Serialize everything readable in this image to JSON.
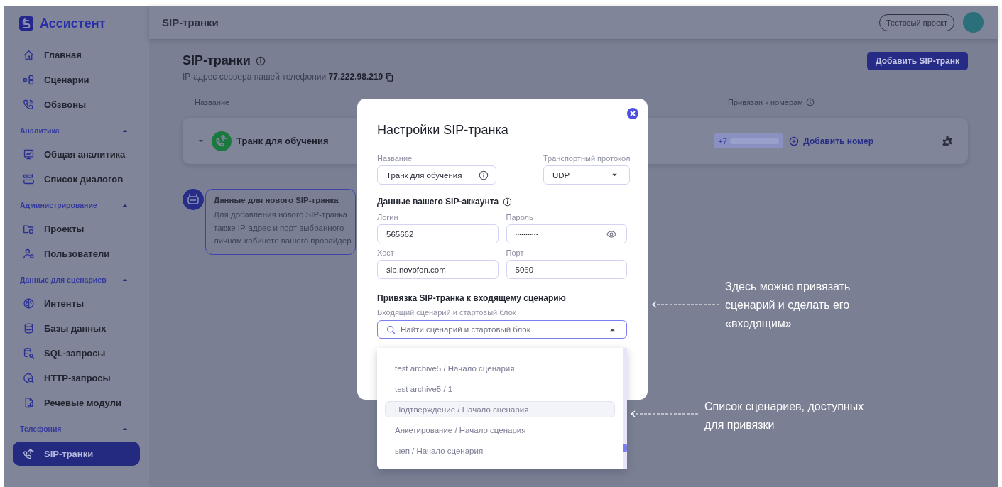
{
  "sidebar": {
    "logo": "Ассистент",
    "nav": [
      {
        "kind": "item",
        "label": "Главная",
        "selected": false
      },
      {
        "kind": "item",
        "label": "Сценарии",
        "selected": false
      },
      {
        "kind": "item",
        "label": "Обзвоны",
        "selected": false
      },
      {
        "kind": "section",
        "label": "Аналитика",
        "expanded": true,
        "children": [
          {
            "kind": "item",
            "label": "Общая аналитика",
            "selected": false
          },
          {
            "kind": "item",
            "label": "Список диалогов",
            "selected": false
          }
        ]
      },
      {
        "kind": "section",
        "label": "Администрирование",
        "expanded": true,
        "children": [
          {
            "kind": "item",
            "label": "Проекты",
            "selected": false
          },
          {
            "kind": "item",
            "label": "Пользователи",
            "selected": false
          }
        ]
      },
      {
        "kind": "section",
        "label": "Данные для сценариев",
        "expanded": true,
        "children": [
          {
            "kind": "item",
            "label": "Интенты",
            "selected": false
          },
          {
            "kind": "item",
            "label": "Базы данных",
            "selected": false
          },
          {
            "kind": "item",
            "label": "SQL-запросы",
            "selected": false
          },
          {
            "kind": "item",
            "label": "HTTP-запросы",
            "selected": false
          },
          {
            "kind": "item",
            "label": "Речевые модули",
            "selected": false
          }
        ]
      },
      {
        "kind": "section",
        "label": "Телефония",
        "expanded": true,
        "children": [
          {
            "kind": "item",
            "label": "SIP-транки",
            "selected": true
          }
        ]
      }
    ]
  },
  "header": {
    "title": "SIP-транки",
    "project": "Тестовый проект"
  },
  "page": {
    "title": "SIP-транки",
    "server_ip": "IP-адрес сервера нашей телефонии **77.222.98.219**",
    "add_button": "Добавить SIP-транк",
    "columns": [
      "Название",
      "Привязан к номерам"
    ],
    "trunks": [
      {
        "name": "Транк для обучения",
        "phone": "+7",
        "add_number": "Добавить номер"
      }
    ],
    "info_card": {
      "title": "Данные для нового SIP-транка",
      "lines": [
        "Для добавления нового SIP-транка",
        "также IP-адрес и порт выбранного",
        "личном кабинете вашего провайдер"
      ]
    }
  },
  "modal": {
    "title": "Настройки SIP-транка",
    "name": {
      "label": "Название",
      "value": "Транк для обучения"
    },
    "protocol": {
      "label": "Транспортный протокол",
      "value": "UDP"
    },
    "account_title": "Данные вашего SIP-аккаунта",
    "account_fields": [
      {
        "kind": "text",
        "label": "Логин",
        "value": "565662"
      },
      {
        "kind": "password",
        "label": "Пароль",
        "value": "•••••••••••"
      },
      {
        "kind": "text",
        "label": "Хост",
        "value": "sip.novofon.com"
      },
      {
        "kind": "text",
        "label": "Порт",
        "value": "5060"
      }
    ],
    "binding_title": "Привязка SIP-транка к входящему сценарию",
    "scenario_label": "Входящий сценарий и стартовый блок",
    "search": {
      "placeholder": "Найти сценарий и стартовый блок"
    },
    "options": [
      {
        "label": "test archive5 / Начало сценария",
        "selected": false
      },
      {
        "label": "test archive5 / 1",
        "selected": false
      },
      {
        "label": "Подтверждение / Начало сценария",
        "selected": true
      },
      {
        "label": "Анкетирование / Начало сценария",
        "selected": false
      },
      {
        "label": "ыеп / Начало сценария",
        "selected": false
      }
    ]
  },
  "annotations": [
    {
      "lines": [
        "Здесь можно привязать",
        "сценарий и сделать его",
        "«входящим»"
      ]
    },
    {
      "lines": [
        "Список сценариев, доступных",
        "для привязки"
      ]
    }
  ]
}
